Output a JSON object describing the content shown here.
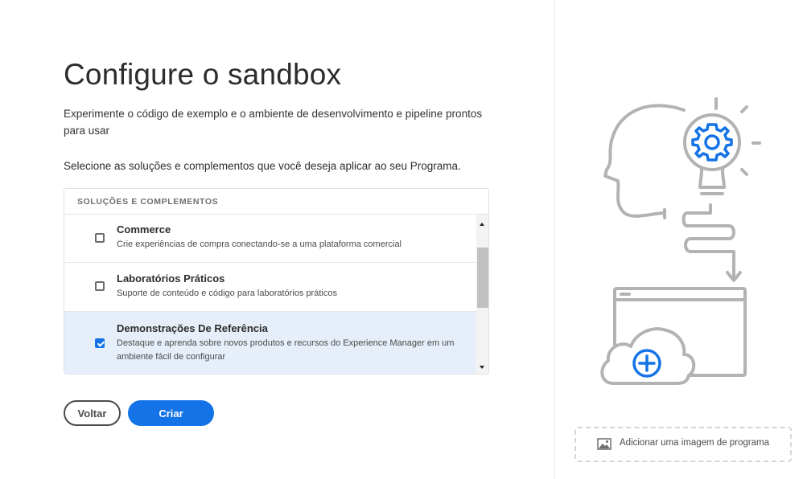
{
  "page": {
    "title": "Configure o sandbox",
    "description": "Experimente o código de exemplo e o ambiente de desenvolvimento e pipeline prontos para usar",
    "instruction": "Selecione as soluções e complementos que você deseja aplicar ao seu Programa."
  },
  "solutions": {
    "header": "SOLUÇÕES E COMPLEMENTOS",
    "items": [
      {
        "title": "Commerce",
        "description": "Crie experiências de compra conectando-se a uma plataforma comercial",
        "checked": false
      },
      {
        "title": "Laboratórios Práticos",
        "description": "Suporte de conteúdo e código para laboratórios práticos",
        "checked": false
      },
      {
        "title": "Demonstrações De Referência",
        "description": "Destaque e aprenda sobre novos produtos e recursos do Experience Manager em um ambiente fácil de configurar",
        "checked": true
      }
    ]
  },
  "buttons": {
    "back": "Voltar",
    "create": "Criar"
  },
  "add_image": {
    "label": "Adicionar uma imagem de programa",
    "icon": "image-icon"
  },
  "colors": {
    "accent": "#1473e6",
    "selected_row": "#e6eef9",
    "illustration_gray": "#b3b3b3"
  }
}
